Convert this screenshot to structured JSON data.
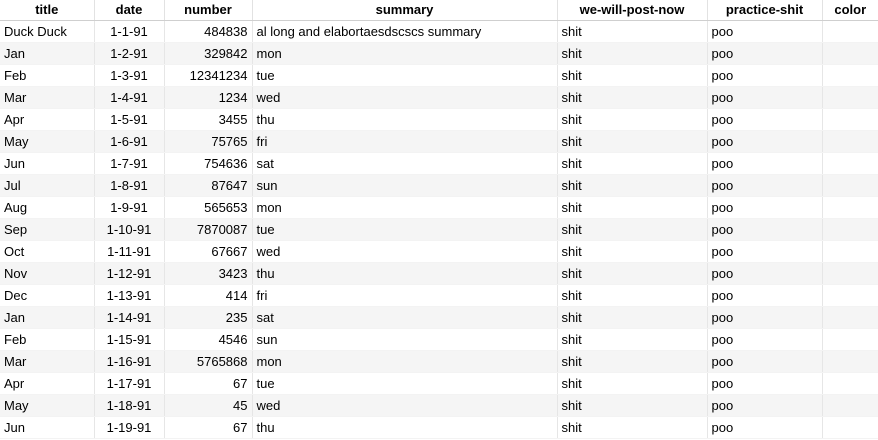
{
  "table": {
    "columns": [
      "title",
      "date",
      "number",
      "summary",
      "we-will-post-now",
      "practice-shit",
      "color"
    ],
    "rows": [
      {
        "title": "Duck Duck",
        "date": "1-1-91",
        "number": "484838",
        "summary": "al long and elabortaesdscscs summary",
        "post": "shit",
        "practice": "poo",
        "color": ""
      },
      {
        "title": "Jan",
        "date": "1-2-91",
        "number": "329842",
        "summary": "mon",
        "post": "shit",
        "practice": "poo",
        "color": ""
      },
      {
        "title": "Feb",
        "date": "1-3-91",
        "number": "12341234",
        "summary": "tue",
        "post": "shit",
        "practice": "poo",
        "color": ""
      },
      {
        "title": "Mar",
        "date": "1-4-91",
        "number": "1234",
        "summary": "wed",
        "post": "shit",
        "practice": "poo",
        "color": ""
      },
      {
        "title": "Apr",
        "date": "1-5-91",
        "number": "3455",
        "summary": "thu",
        "post": "shit",
        "practice": "poo",
        "color": ""
      },
      {
        "title": "May",
        "date": "1-6-91",
        "number": "75765",
        "summary": "fri",
        "post": "shit",
        "practice": "poo",
        "color": ""
      },
      {
        "title": "Jun",
        "date": "1-7-91",
        "number": "754636",
        "summary": "sat",
        "post": "shit",
        "practice": "poo",
        "color": ""
      },
      {
        "title": "Jul",
        "date": "1-8-91",
        "number": "87647",
        "summary": "sun",
        "post": "shit",
        "practice": "poo",
        "color": ""
      },
      {
        "title": "Aug",
        "date": "1-9-91",
        "number": "565653",
        "summary": "mon",
        "post": "shit",
        "practice": "poo",
        "color": ""
      },
      {
        "title": "Sep",
        "date": "1-10-91",
        "number": "7870087",
        "summary": "tue",
        "post": "shit",
        "practice": "poo",
        "color": ""
      },
      {
        "title": "Oct",
        "date": "1-11-91",
        "number": "67667",
        "summary": "wed",
        "post": "shit",
        "practice": "poo",
        "color": ""
      },
      {
        "title": "Nov",
        "date": "1-12-91",
        "number": "3423",
        "summary": "thu",
        "post": "shit",
        "practice": "poo",
        "color": ""
      },
      {
        "title": "Dec",
        "date": "1-13-91",
        "number": "414",
        "summary": "fri",
        "post": "shit",
        "practice": "poo",
        "color": ""
      },
      {
        "title": "Jan",
        "date": "1-14-91",
        "number": "235",
        "summary": "sat",
        "post": "shit",
        "practice": "poo",
        "color": ""
      },
      {
        "title": "Feb",
        "date": "1-15-91",
        "number": "4546",
        "summary": "sun",
        "post": "shit",
        "practice": "poo",
        "color": ""
      },
      {
        "title": "Mar",
        "date": "1-16-91",
        "number": "5765868",
        "summary": "mon",
        "post": "shit",
        "practice": "poo",
        "color": ""
      },
      {
        "title": "Apr",
        "date": "1-17-91",
        "number": "67",
        "summary": "tue",
        "post": "shit",
        "practice": "poo",
        "color": ""
      },
      {
        "title": "May",
        "date": "1-18-91",
        "number": "45",
        "summary": "wed",
        "post": "shit",
        "practice": "poo",
        "color": ""
      },
      {
        "title": "Jun",
        "date": "1-19-91",
        "number": "67",
        "summary": "thu",
        "post": "shit",
        "practice": "poo",
        "color": ""
      }
    ]
  }
}
